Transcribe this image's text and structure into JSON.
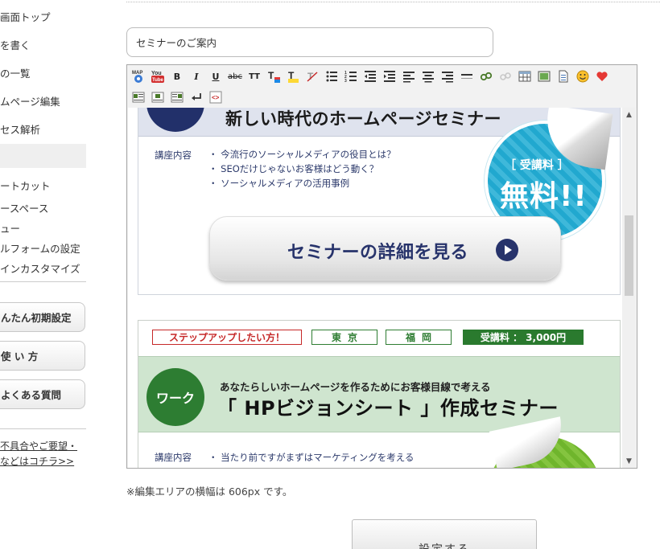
{
  "sidebar": {
    "items": [
      {
        "label": "画面トップ"
      },
      {
        "label": "を書く"
      },
      {
        "label": "の一覧"
      },
      {
        "label": "ムページ編集"
      },
      {
        "label": "セス解析"
      }
    ],
    "items2": [
      {
        "label": "ートカット"
      },
      {
        "label": "ースペース"
      },
      {
        "label": "ュー"
      },
      {
        "label": "ルフォームの設定"
      },
      {
        "label": "インカスタマイズ"
      }
    ],
    "buttons": [
      {
        "label": "んたん初期設定"
      },
      {
        "label": "使 い 方"
      },
      {
        "label": "よくある質問"
      }
    ],
    "feedback_line1": "不具合やご要望・",
    "feedback_line2": "などはコチラ>>"
  },
  "title_input": {
    "value": "セミナーのご案内"
  },
  "toolbar": {
    "row1": [
      "map-icon",
      "youtube-icon",
      "bold",
      "italic",
      "underline",
      "strike",
      "font-size",
      "font-color",
      "highlight",
      "clear-format",
      "bullet-list",
      "number-list",
      "outdent",
      "indent",
      "align-left",
      "align-center",
      "align-right",
      "horizontal-rule",
      "link-icon",
      "unlink-icon",
      "table-icon",
      "image-icon",
      "document-icon",
      "emoji-icon",
      "heart-icon"
    ],
    "row2": [
      "template1-icon",
      "template2-icon",
      "template3-icon",
      "newline-icon",
      "source-icon"
    ],
    "bold": "B",
    "italic": "I",
    "underline": "U",
    "strike": "abc",
    "font_size": "TT",
    "font_color": "T"
  },
  "seminar1": {
    "title": "新しい時代のホームページセミナー",
    "course_label": "講座内容",
    "items": [
      "・ 今流行のソーシャルメディアの役目とは？",
      "・ SEOだけじゃないお客様はどう動く？",
      "・ ソーシャルメディアの活用事例"
    ],
    "badge_sub": "［ 受講料 ］",
    "badge_main": "無料!!",
    "detail_button": "セミナーの詳細を見る"
  },
  "seminar2": {
    "tags": {
      "stepup": "ステップアップしたい方！",
      "tokyo": "東京",
      "fukuoka": "福岡",
      "fee": "受講料 ： 3,000円"
    },
    "circle_label": "ワーク",
    "subtitle": "あなたらしいホームページを作るためにお客様目線で考える",
    "title": "「 HPビジョンシート 」作成セミナー",
    "course_label": "講座内容",
    "item1": "・ 当たり前ですがまずはマーケティングを考える"
  },
  "note": "※編集エリアの横幅は 606px です。",
  "submit_label": "設定する",
  "colors": {
    "navy": "#22306a",
    "green": "#2d7d32",
    "cyan": "#21a8cf",
    "red": "#c62828"
  }
}
